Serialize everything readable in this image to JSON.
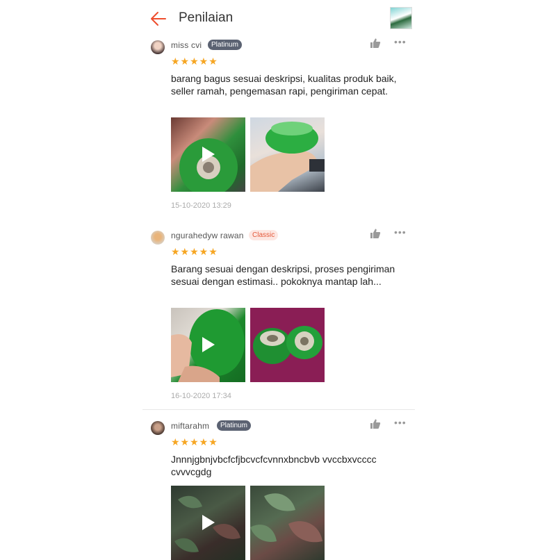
{
  "header": {
    "title": "Penilaian",
    "back_icon": "arrow-left-icon"
  },
  "colors": {
    "accent": "#ee4d2d",
    "star": "#f6a623",
    "platinum": "#5b6272",
    "classic_text": "#e4593a"
  },
  "reviews": [
    {
      "username": "miss cvi",
      "badge": "Platinum",
      "stars": "★★★★★",
      "rating": 5,
      "text": "barang bagus sesuai deskripsi, kualitas produk baik, seller ramah, pengemasan rapi, pengiriman cepat.",
      "date": "15-10-2020 13:29",
      "media": [
        "video",
        "photo"
      ]
    },
    {
      "username": "ngurahedyw rawan",
      "badge": "Classic",
      "stars": "★★★★★",
      "rating": 5,
      "text": "Barang sesuai dengan deskripsi, proses pengiriman sesuai dengan estimasi.. pokoknya mantap lah...",
      "date": "16-10-2020 17:34",
      "media": [
        "video",
        "photo"
      ]
    },
    {
      "username": "miftarahm",
      "badge": "Platinum",
      "stars": "★★★★★",
      "rating": 5,
      "text": "Jnnnjgbnjvbcfcfjbcvcfcvnnxbncbvb vvccbxvcccc cvvvcgdg",
      "media": [
        "video",
        "photo"
      ]
    }
  ],
  "icons": {
    "like": "thumbs-up-icon",
    "more": "more-dots-icon",
    "play": "play-icon"
  },
  "more_label": "•••"
}
